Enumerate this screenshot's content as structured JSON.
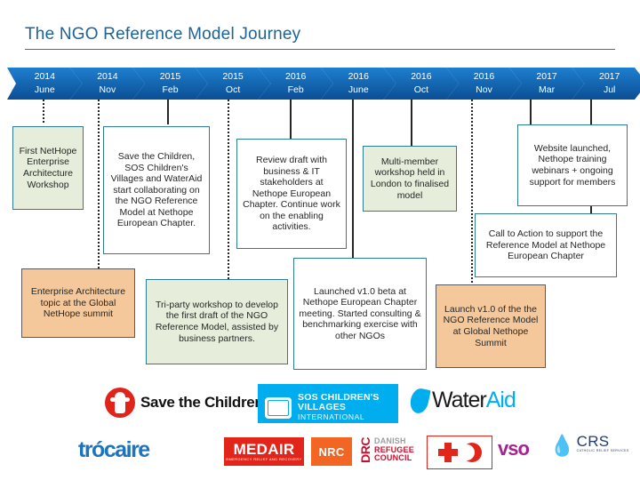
{
  "title": "The NGO Reference Model Journey",
  "colors": {
    "title_blue": "#1F6394",
    "arrow_blue": "#1569B4",
    "box_border": "#2E7B96",
    "box_green": "#E6EEDB",
    "box_orange": "#F5C89B",
    "connector": "#262626"
  },
  "timeline": {
    "milestones": [
      {
        "year": "2014",
        "month": "June"
      },
      {
        "year": "2014",
        "month": "Nov"
      },
      {
        "year": "2015",
        "month": "Feb"
      },
      {
        "year": "2015",
        "month": "Oct"
      },
      {
        "year": "2016",
        "month": "Feb"
      },
      {
        "year": "2016",
        "month": "June"
      },
      {
        "year": "2016",
        "month": "Oct"
      },
      {
        "year": "2016",
        "month": "Nov"
      },
      {
        "year": "2017",
        "month": "Mar"
      },
      {
        "year": "2017",
        "month": "Jul"
      }
    ]
  },
  "callouts": {
    "upper": [
      {
        "text": "First NetHope Enterprise Architecture Workshop",
        "fill": "green"
      },
      {
        "text": "Save the Children, SOS Children's Villages and WaterAid start collaborating on the NGO Reference Model at Nethope European Chapter.",
        "fill": "white"
      },
      {
        "text": "Review draft with business & IT stakeholders at Nethope European Chapter. Continue work on the enabling activities.",
        "fill": "white"
      },
      {
        "text": "Multi-member workshop held in London to finalised model",
        "fill": "green"
      },
      {
        "text": "Website launched, Nethope training webinars + ongoing support for members",
        "fill": "white"
      },
      {
        "text": "Call to Action to support the Reference Model at Nethope European Chapter",
        "fill": "white"
      }
    ],
    "lower": [
      {
        "text": "Enterprise Architecture topic at the Global NetHope summit",
        "fill": "orange"
      },
      {
        "text": "Tri-party workshop to develop the first draft of the NGO Reference Model, assisted by business partners.",
        "fill": "green"
      },
      {
        "text": "Launched v1.0 beta at Nethope European Chapter meeting. Started consulting & benchmarking exercise with other NGOs",
        "fill": "white"
      },
      {
        "text": "Launch v1.0 of the the NGO Reference Model at Global Nethope Summit",
        "fill": "orange"
      }
    ]
  },
  "logos": {
    "save_the_children": "Save the Children.",
    "sos_line1": "SOS CHILDREN'S",
    "sos_line2": "VILLAGES",
    "sos_line3": "INTERNATIONAL",
    "wateraid_water": "Water",
    "wateraid_aid": "Aid",
    "trocaire": "trócaire",
    "medair_name": "MEDAIR",
    "medair_tagline": "EMERGENCY RELIEF AND RECOVERY",
    "nrc": "NRC",
    "drc_mark": "DRC",
    "drc_line1": "DANISH",
    "drc_line2": "REFUGEE",
    "drc_line3": "COUNCIL",
    "vso": "vso",
    "crs_name": "CRS",
    "crs_tagline": "CATHOLIC RELIEF SERVICES"
  }
}
